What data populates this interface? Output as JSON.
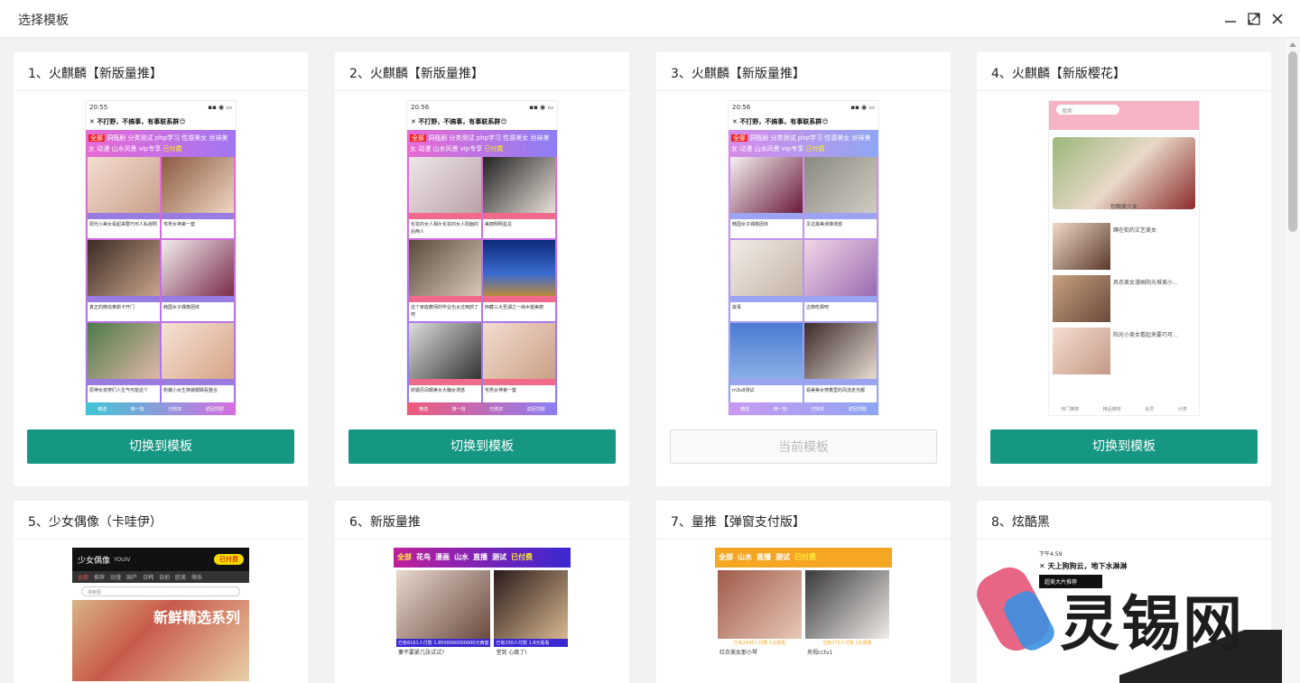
{
  "window": {
    "title": "选择模板"
  },
  "templates": [
    {
      "title": "1、火麒麟【新版量推】",
      "button": "切换到模板",
      "current": false,
      "time": "20:55",
      "group_title": "不打野，不搞事，有事联系群",
      "tags": [
        "全部",
        "洞瓶剧",
        "分类测试",
        "php学习",
        "性感美女",
        "丝袜美女",
        "动漫",
        "山水风景",
        "vip专享",
        "已付费"
      ],
      "captions": [
        "阳光小美女看起来要巧可人私房照",
        "宅男女神第一套",
        "真正的微信奥斯卡开门",
        "韩国女子偶像团体",
        "原神女孩穿们人生气可能这个",
        "粉嫩小女生换装眼睛看整合"
      ],
      "footer": [
        "精选",
        "换一批",
        "已购买",
        "返回顶部"
      ]
    },
    {
      "title": "2、火麒麟【新版量推】",
      "button": "切换到模板",
      "current": false,
      "time": "20:56",
      "group_title": "不打野，不搞事，有事联系群",
      "tags": [
        "全部",
        "洞瓶剧",
        "分类测试",
        "php学习",
        "性感美女",
        "丝袜美女",
        "动漫",
        "山水风景",
        "vip专享",
        "已付费"
      ],
      "captions": [
        "化妆的女人相片化妆的女人阳面的后两人",
        "美丽明明星总",
        "这个家庭教师的毕业也太过两抓了吧",
        "西藏三大圣湖之一纳木错美丽",
        "妖媚丹凤眼美女大胸女诱惑",
        "宅男女神第一套"
      ],
      "footer": [
        "精选",
        "换一批",
        "已购买",
        "返回顶部"
      ]
    },
    {
      "title": "3、火麒麟【新版量推】",
      "button": "当前模板",
      "current": true,
      "time": "20:56",
      "group_title": "不打野，不搞事，有事联系群",
      "tags": [
        "全部",
        "洞瓶剧",
        "分类测试",
        "php学习",
        "性感美女",
        "丝袜美女",
        "动漫",
        "山水风景",
        "vip专享",
        "已付费"
      ],
      "captions": [
        "韩国女子偶像团体",
        "见过最美滑梯诱惑",
        "故事",
        "古典吃相吧",
        "m3u8测试",
        "看美美女穿着里的风流走光都"
      ],
      "footer": [
        "精选",
        "换一批",
        "已购买",
        "返回顶部"
      ]
    },
    {
      "title": "4、火麒麟【新版樱花】",
      "button": "切换到模板",
      "current": false,
      "search": "搜索",
      "banner_caption": "包眼美少女",
      "captions": [
        "蹲在街的文艺美女",
        "风衣美女漫画阳光堆美小...",
        "阳光小美女看起来要巧可..."
      ],
      "footer": [
        "热门推荐",
        "精品推荐",
        "会员",
        "分类"
      ]
    },
    {
      "title": "5、少女偶像（卡哇伊）",
      "logo": "少女偶像",
      "logo_sub": "YOUIV",
      "paid": "已付费",
      "nav": [
        "全部",
        "推荐",
        "动漫",
        "国产",
        "日韩",
        "自拍",
        "欧美",
        "萌系"
      ],
      "search": "搜索图",
      "banner": "新鲜精选系列"
    },
    {
      "title": "6、新版量推",
      "tags": [
        "全部",
        "花鸟",
        "漫画",
        "山水",
        "直播",
        "测试",
        "已付费"
      ],
      "meta1": "已有6161人付款 1.8500000000000元两套",
      "meta2": "已有150人付款 1.8元看看",
      "cap1": "妻不要紧几张试试?",
      "cap2": "堂到 心跳了!"
    },
    {
      "title": "7、量推【弹窗支付版】",
      "tags": [
        "全部",
        "山水",
        "直播",
        "测试",
        "已付费"
      ],
      "meta1": "已有2435人付款 1元观看",
      "meta2": "已有775人付款 1元观看",
      "cap1": "红衣美女那小琴",
      "cap2": "央视cctv1"
    },
    {
      "title": "8、炫酷黑",
      "time": "下午4:59",
      "banner": "天上狗狗云，地下水淋淋",
      "tag": "超美大片推荐"
    }
  ],
  "watermark": {
    "text": "灵锡网"
  },
  "colors": {
    "accent": "#169782",
    "current_bg": "#fafafa"
  }
}
